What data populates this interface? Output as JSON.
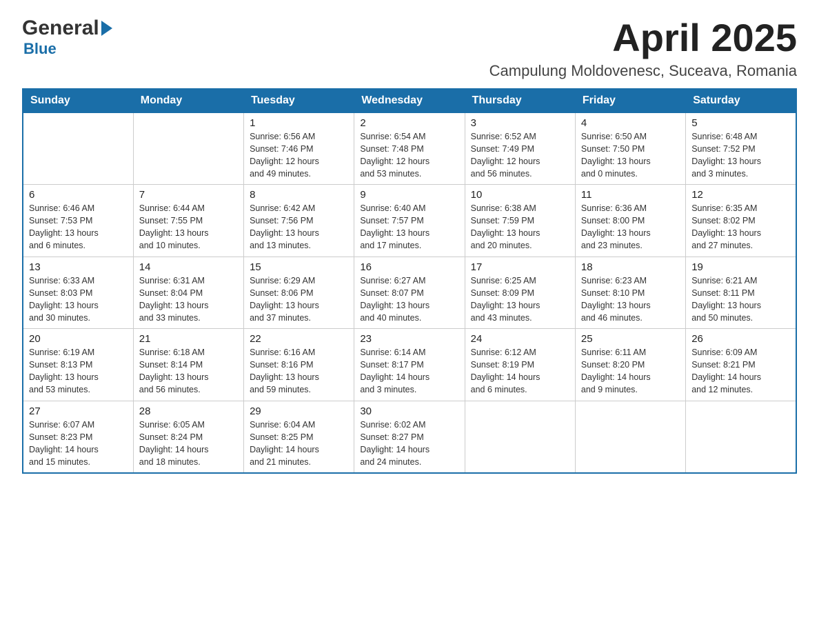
{
  "logo": {
    "general": "General",
    "blue": "Blue",
    "arrow": "▶"
  },
  "header": {
    "month": "April 2025",
    "location": "Campulung Moldovenesc, Suceava, Romania"
  },
  "days_of_week": [
    "Sunday",
    "Monday",
    "Tuesday",
    "Wednesday",
    "Thursday",
    "Friday",
    "Saturday"
  ],
  "weeks": [
    [
      {
        "day": "",
        "info": ""
      },
      {
        "day": "",
        "info": ""
      },
      {
        "day": "1",
        "info": "Sunrise: 6:56 AM\nSunset: 7:46 PM\nDaylight: 12 hours\nand 49 minutes."
      },
      {
        "day": "2",
        "info": "Sunrise: 6:54 AM\nSunset: 7:48 PM\nDaylight: 12 hours\nand 53 minutes."
      },
      {
        "day": "3",
        "info": "Sunrise: 6:52 AM\nSunset: 7:49 PM\nDaylight: 12 hours\nand 56 minutes."
      },
      {
        "day": "4",
        "info": "Sunrise: 6:50 AM\nSunset: 7:50 PM\nDaylight: 13 hours\nand 0 minutes."
      },
      {
        "day": "5",
        "info": "Sunrise: 6:48 AM\nSunset: 7:52 PM\nDaylight: 13 hours\nand 3 minutes."
      }
    ],
    [
      {
        "day": "6",
        "info": "Sunrise: 6:46 AM\nSunset: 7:53 PM\nDaylight: 13 hours\nand 6 minutes."
      },
      {
        "day": "7",
        "info": "Sunrise: 6:44 AM\nSunset: 7:55 PM\nDaylight: 13 hours\nand 10 minutes."
      },
      {
        "day": "8",
        "info": "Sunrise: 6:42 AM\nSunset: 7:56 PM\nDaylight: 13 hours\nand 13 minutes."
      },
      {
        "day": "9",
        "info": "Sunrise: 6:40 AM\nSunset: 7:57 PM\nDaylight: 13 hours\nand 17 minutes."
      },
      {
        "day": "10",
        "info": "Sunrise: 6:38 AM\nSunset: 7:59 PM\nDaylight: 13 hours\nand 20 minutes."
      },
      {
        "day": "11",
        "info": "Sunrise: 6:36 AM\nSunset: 8:00 PM\nDaylight: 13 hours\nand 23 minutes."
      },
      {
        "day": "12",
        "info": "Sunrise: 6:35 AM\nSunset: 8:02 PM\nDaylight: 13 hours\nand 27 minutes."
      }
    ],
    [
      {
        "day": "13",
        "info": "Sunrise: 6:33 AM\nSunset: 8:03 PM\nDaylight: 13 hours\nand 30 minutes."
      },
      {
        "day": "14",
        "info": "Sunrise: 6:31 AM\nSunset: 8:04 PM\nDaylight: 13 hours\nand 33 minutes."
      },
      {
        "day": "15",
        "info": "Sunrise: 6:29 AM\nSunset: 8:06 PM\nDaylight: 13 hours\nand 37 minutes."
      },
      {
        "day": "16",
        "info": "Sunrise: 6:27 AM\nSunset: 8:07 PM\nDaylight: 13 hours\nand 40 minutes."
      },
      {
        "day": "17",
        "info": "Sunrise: 6:25 AM\nSunset: 8:09 PM\nDaylight: 13 hours\nand 43 minutes."
      },
      {
        "day": "18",
        "info": "Sunrise: 6:23 AM\nSunset: 8:10 PM\nDaylight: 13 hours\nand 46 minutes."
      },
      {
        "day": "19",
        "info": "Sunrise: 6:21 AM\nSunset: 8:11 PM\nDaylight: 13 hours\nand 50 minutes."
      }
    ],
    [
      {
        "day": "20",
        "info": "Sunrise: 6:19 AM\nSunset: 8:13 PM\nDaylight: 13 hours\nand 53 minutes."
      },
      {
        "day": "21",
        "info": "Sunrise: 6:18 AM\nSunset: 8:14 PM\nDaylight: 13 hours\nand 56 minutes."
      },
      {
        "day": "22",
        "info": "Sunrise: 6:16 AM\nSunset: 8:16 PM\nDaylight: 13 hours\nand 59 minutes."
      },
      {
        "day": "23",
        "info": "Sunrise: 6:14 AM\nSunset: 8:17 PM\nDaylight: 14 hours\nand 3 minutes."
      },
      {
        "day": "24",
        "info": "Sunrise: 6:12 AM\nSunset: 8:19 PM\nDaylight: 14 hours\nand 6 minutes."
      },
      {
        "day": "25",
        "info": "Sunrise: 6:11 AM\nSunset: 8:20 PM\nDaylight: 14 hours\nand 9 minutes."
      },
      {
        "day": "26",
        "info": "Sunrise: 6:09 AM\nSunset: 8:21 PM\nDaylight: 14 hours\nand 12 minutes."
      }
    ],
    [
      {
        "day": "27",
        "info": "Sunrise: 6:07 AM\nSunset: 8:23 PM\nDaylight: 14 hours\nand 15 minutes."
      },
      {
        "day": "28",
        "info": "Sunrise: 6:05 AM\nSunset: 8:24 PM\nDaylight: 14 hours\nand 18 minutes."
      },
      {
        "day": "29",
        "info": "Sunrise: 6:04 AM\nSunset: 8:25 PM\nDaylight: 14 hours\nand 21 minutes."
      },
      {
        "day": "30",
        "info": "Sunrise: 6:02 AM\nSunset: 8:27 PM\nDaylight: 14 hours\nand 24 minutes."
      },
      {
        "day": "",
        "info": ""
      },
      {
        "day": "",
        "info": ""
      },
      {
        "day": "",
        "info": ""
      }
    ]
  ]
}
